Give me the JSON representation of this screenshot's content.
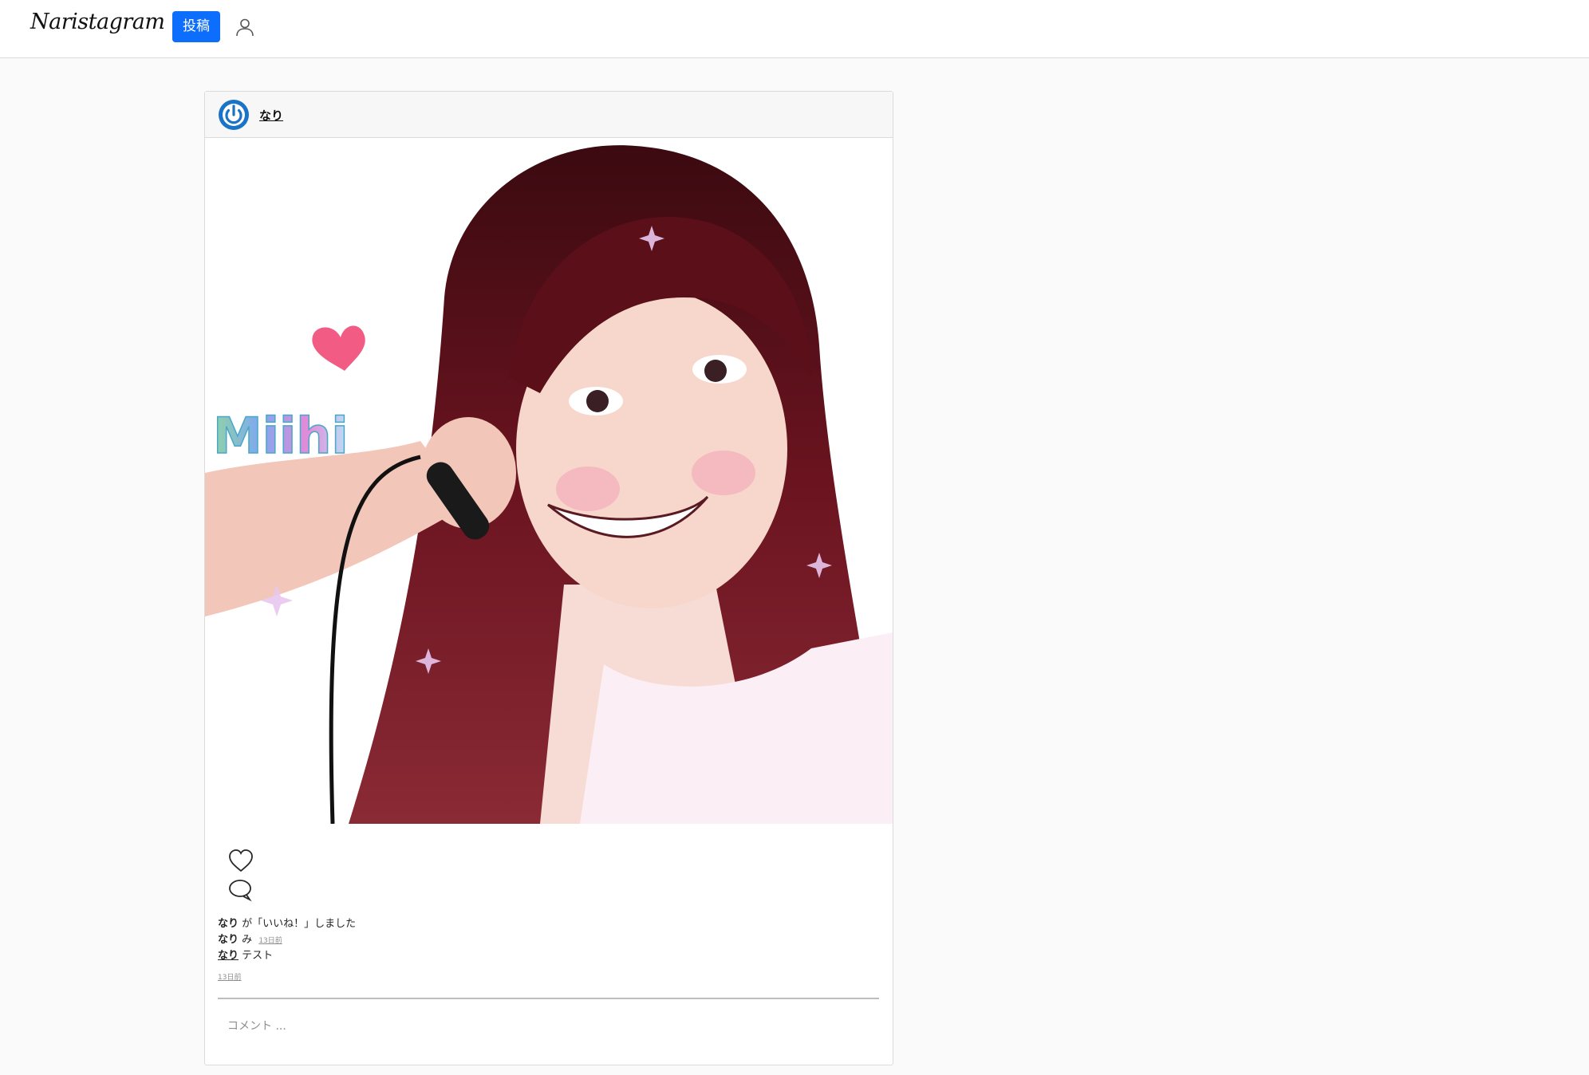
{
  "header": {
    "logo": "Naristagram",
    "post_button": "投稿",
    "user_icon": "user-icon"
  },
  "post": {
    "username": "なり",
    "image_alt": "illustration",
    "image_text": "Miihi",
    "likes_line": {
      "user": "なり",
      "text": "が「いいね！」しました"
    },
    "comments": [
      {
        "user": "なり",
        "text": "み",
        "time": "13日前"
      }
    ],
    "caption": {
      "user": "なり",
      "text": "テスト"
    },
    "time": "13日前",
    "comment_placeholder": "コメント ..."
  },
  "colors": {
    "accent": "#0d6efd",
    "avatar_ring": "#1a73c7",
    "hair": "#6b1420"
  }
}
